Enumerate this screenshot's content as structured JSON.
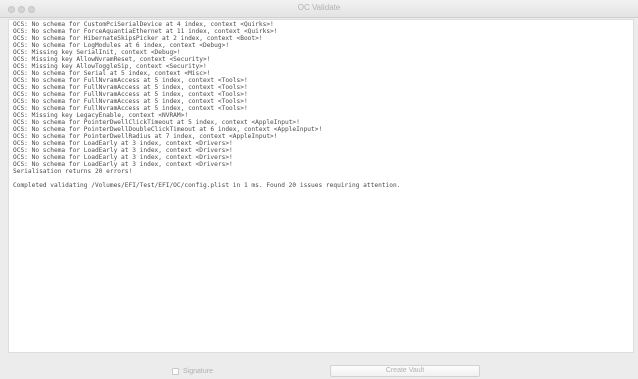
{
  "window": {
    "title": "OC Validate"
  },
  "log": {
    "lines": [
      "OCS: No schema for CustomPciSerialDevice at 4 index, context <Quirks>!",
      "OCS: No schema for ForceAquantiaEthernet at 11 index, context <Quirks>!",
      "OCS: No schema for HibernateSkipsPicker at 2 index, context <Boot>!",
      "OCS: No schema for LogModules at 6 index, context <Debug>!",
      "OCS: Missing key SerialInit, context <Debug>!",
      "OCS: Missing key AllowNvramReset, context <Security>!",
      "OCS: Missing key AllowToggleSip, context <Security>!",
      "OCS: No schema for Serial at 5 index, context <Misc>!",
      "OCS: No schema for FullNvramAccess at 5 index, context <Tools>!",
      "OCS: No schema for FullNvramAccess at 5 index, context <Tools>!",
      "OCS: No schema for FullNvramAccess at 5 index, context <Tools>!",
      "OCS: No schema for FullNvramAccess at 5 index, context <Tools>!",
      "OCS: No schema for FullNvramAccess at 5 index, context <Tools>!",
      "OCS: Missing key LegacyEnable, context <NVRAM>!",
      "OCS: No schema for PointerDwellClickTimeout at 5 index, context <AppleInput>!",
      "OCS: No schema for PointerDwellDoubleClickTimeout at 6 index, context <AppleInput>!",
      "OCS: No schema for PointerDwellRadius at 7 index, context <AppleInput>!",
      "OCS: No schema for LoadEarly at 3 index, context <Drivers>!",
      "OCS: No schema for LoadEarly at 3 index, context <Drivers>!",
      "OCS: No schema for LoadEarly at 3 index, context <Drivers>!",
      "OCS: No schema for LoadEarly at 3 index, context <Drivers>!",
      "Serialisation returns 20 errors!",
      "",
      "Completed validating /Volumes/EFI/Test/EFI/OC/config.plist in 1 ms. Found 20 issues requiring attention."
    ]
  },
  "footer": {
    "signature_label": "Signature",
    "signature_checked": false,
    "create_vault_label": "Create Vault"
  }
}
